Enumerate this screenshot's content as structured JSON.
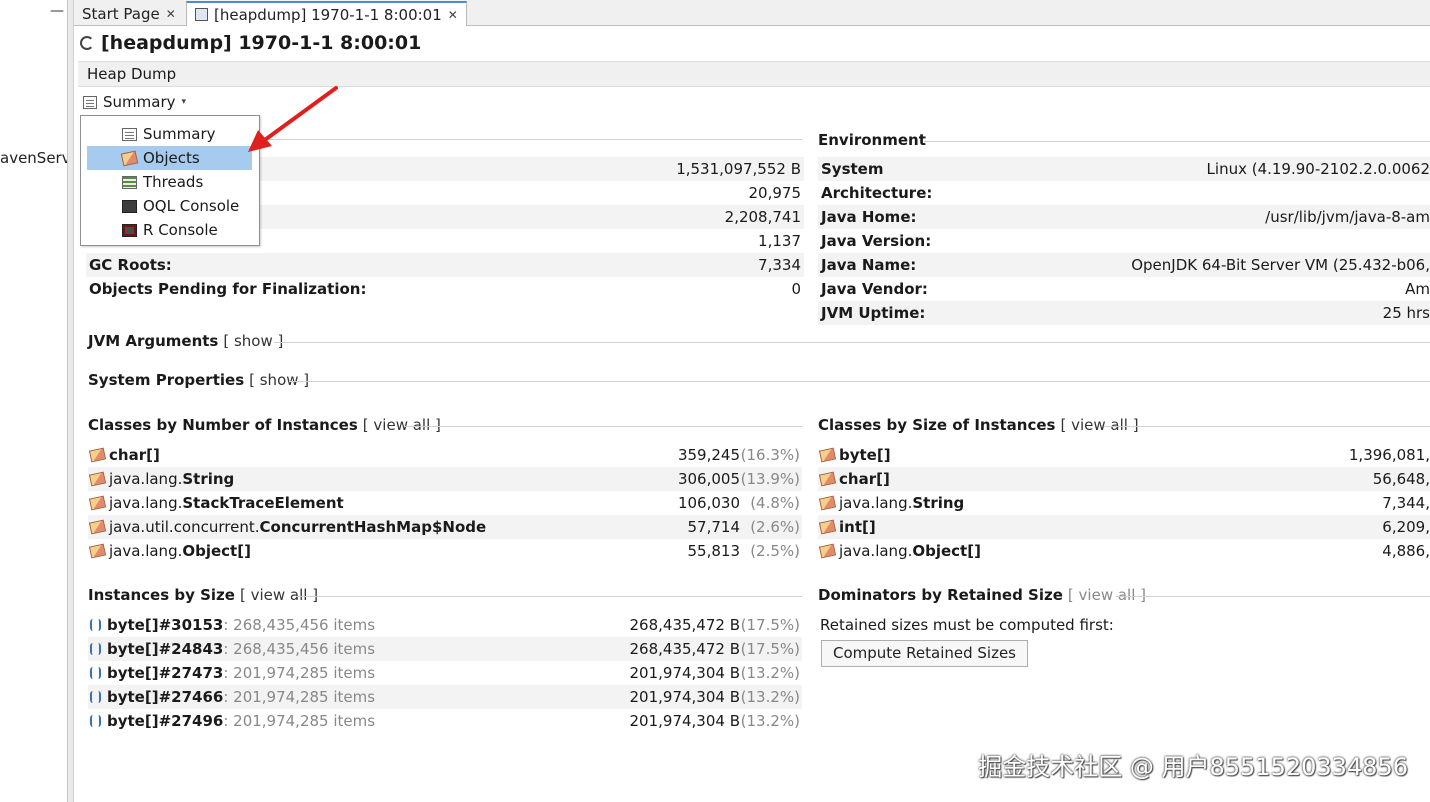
{
  "left": {
    "minimize": "—",
    "node_label": "avenServ"
  },
  "tabs": [
    {
      "label": "Start Page",
      "close": "✕"
    },
    {
      "label": "[heapdump] 1970-1-1 8:00:01",
      "close": "✕"
    }
  ],
  "page_title": "[heapdump] 1970-1-1 8:00:01",
  "bar_label": "Heap Dump",
  "view_select": {
    "label": "Summary",
    "caret": "▾"
  },
  "dropdown": [
    {
      "label": "Summary",
      "icon": "summary-icon"
    },
    {
      "label": "Objects",
      "icon": "objects-icon",
      "selected": true
    },
    {
      "label": "Threads",
      "icon": "threads-icon"
    },
    {
      "label": "OQL Console",
      "icon": "oql-console-icon"
    },
    {
      "label": "R Console",
      "icon": "r-console-icon"
    }
  ],
  "basic_info": {
    "values": [
      "1,531,097,552 B",
      "20,975",
      "2,208,741",
      "1,137"
    ],
    "gc_roots": {
      "key": "GC Roots:",
      "value": "7,334"
    },
    "pending": {
      "key": "Objects Pending for Finalization:",
      "value": "0"
    }
  },
  "environment": {
    "title": "Environment",
    "rows": [
      {
        "key": "System",
        "value": "Linux (4.19.90-2102.2.0.0062"
      },
      {
        "key": "Architecture:",
        "value": ""
      },
      {
        "key": "Java Home:",
        "value": "/usr/lib/jvm/java-8-am"
      },
      {
        "key": "Java Version:",
        "value": ""
      },
      {
        "key": "Java Name:",
        "value": "OpenJDK 64-Bit Server VM (25.432-b06,"
      },
      {
        "key": "Java Vendor:",
        "value": "Am"
      },
      {
        "key": "JVM Uptime:",
        "value": "25 hrs"
      }
    ]
  },
  "jvm_args": {
    "title": "JVM Arguments",
    "link": "[ show ]"
  },
  "sys_props": {
    "title": "System Properties",
    "link": "[ show ]"
  },
  "classes_by_number": {
    "title": "Classes by Number of Instances",
    "link": "[ view all ]",
    "rows": [
      {
        "prefix": "",
        "name": "char[]",
        "count": "359,245",
        "pct": "(16.3%)"
      },
      {
        "prefix": "java.lang.",
        "name": "String",
        "count": "306,005",
        "pct": "(13.9%)"
      },
      {
        "prefix": "java.lang.",
        "name": "StackTraceElement",
        "count": "106,030",
        "pct": "(4.8%)"
      },
      {
        "prefix": "java.util.concurrent.",
        "name": "ConcurrentHashMap$Node",
        "count": "57,714",
        "pct": "(2.6%)"
      },
      {
        "prefix": "java.lang.",
        "name": "Object[]",
        "count": "55,813",
        "pct": "(2.5%)"
      }
    ]
  },
  "classes_by_size": {
    "title": "Classes by Size of Instances",
    "link": "[ view all ]",
    "rows": [
      {
        "prefix": "",
        "name": "byte[]",
        "size": "1,396,081,"
      },
      {
        "prefix": "",
        "name": "char[]",
        "size": "56,648,"
      },
      {
        "prefix": "java.lang.",
        "name": "String",
        "size": "7,344,"
      },
      {
        "prefix": "",
        "name": "int[]",
        "size": "6,209,"
      },
      {
        "prefix": "java.lang.",
        "name": "Object[]",
        "size": "4,886,"
      }
    ]
  },
  "instances_by_size": {
    "title": "Instances by Size",
    "link": "[ view all ]",
    "rows": [
      {
        "name": "byte[]#30153",
        "items": ": 268,435,456 items",
        "size": "268,435,472 B",
        "pct": "(17.5%)"
      },
      {
        "name": "byte[]#24843",
        "items": ": 268,435,456 items",
        "size": "268,435,472 B",
        "pct": "(17.5%)"
      },
      {
        "name": "byte[]#27473",
        "items": ": 201,974,285 items",
        "size": "201,974,304 B",
        "pct": "(13.2%)"
      },
      {
        "name": "byte[]#27466",
        "items": ": 201,974,285 items",
        "size": "201,974,304 B",
        "pct": "(13.2%)"
      },
      {
        "name": "byte[]#27496",
        "items": ": 201,974,285 items",
        "size": "201,974,304 B",
        "pct": "(13.2%)"
      }
    ]
  },
  "dominators": {
    "title": "Dominators by Retained Size",
    "link": "[ view all ]",
    "note": "Retained sizes must be computed first:",
    "button": "Compute Retained Sizes"
  },
  "watermark": "掘金技术社区 @ 用户8551520334856"
}
